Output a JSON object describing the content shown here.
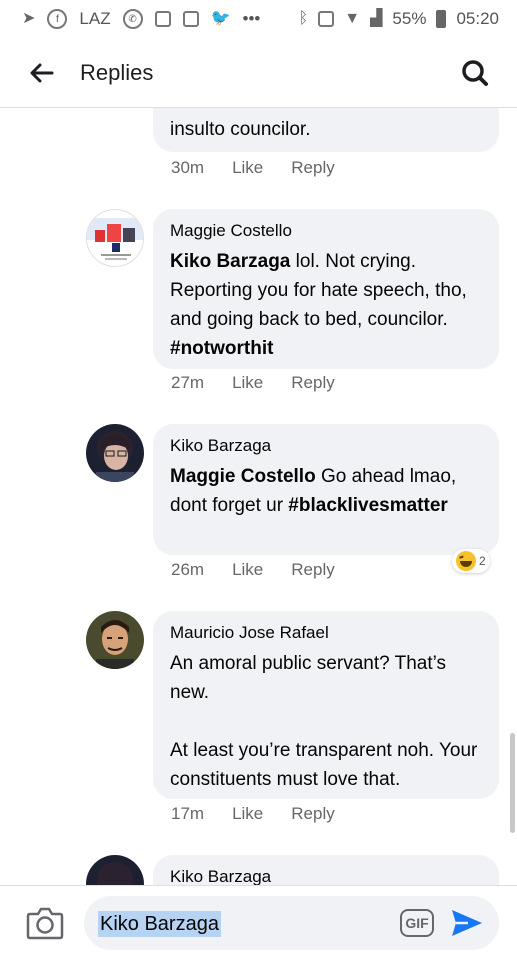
{
  "status_bar": {
    "carrier_text": "LAZ",
    "more": "•••",
    "battery_percent": "55%",
    "time": "05:20"
  },
  "header": {
    "title": "Replies"
  },
  "comments": [
    {
      "author": "",
      "body_tail": "insulto councilor.",
      "time": "30m",
      "like_label": "Like",
      "reply_label": "Reply"
    },
    {
      "author": "Maggie Costello",
      "mention": "Kiko Barzaga",
      "text_part1": " lol. Not crying. Reporting you for hate speech, tho, and going back to bed, councilor. ",
      "hashtag": "#notworthit",
      "time": "27m",
      "like_label": "Like",
      "reply_label": "Reply"
    },
    {
      "author": "Kiko Barzaga",
      "mention": "Maggie Costello",
      "text_part1": " Go ahead lmao, dont forget ur ",
      "hashtag": "#blacklivesmatter",
      "time": "26m",
      "like_label": "Like",
      "reply_label": "Reply",
      "reaction": {
        "icon": "haha-icon",
        "count": "2"
      }
    },
    {
      "author": "Mauricio Jose Rafael",
      "paragraph1": "An amoral public servant? That’s new.",
      "paragraph2": "At least you’re transparent noh. Your constituents must love that.",
      "time": "17m",
      "like_label": "Like",
      "reply_label": "Reply"
    },
    {
      "author": "Kiko Barzaga"
    }
  ],
  "composer": {
    "input_value": "Kiko Barzaga",
    "gif_label": "GIF"
  },
  "colors": {
    "accent": "#1877f2",
    "bubble": "#f0f2f5",
    "secondary_text": "#65676b"
  }
}
